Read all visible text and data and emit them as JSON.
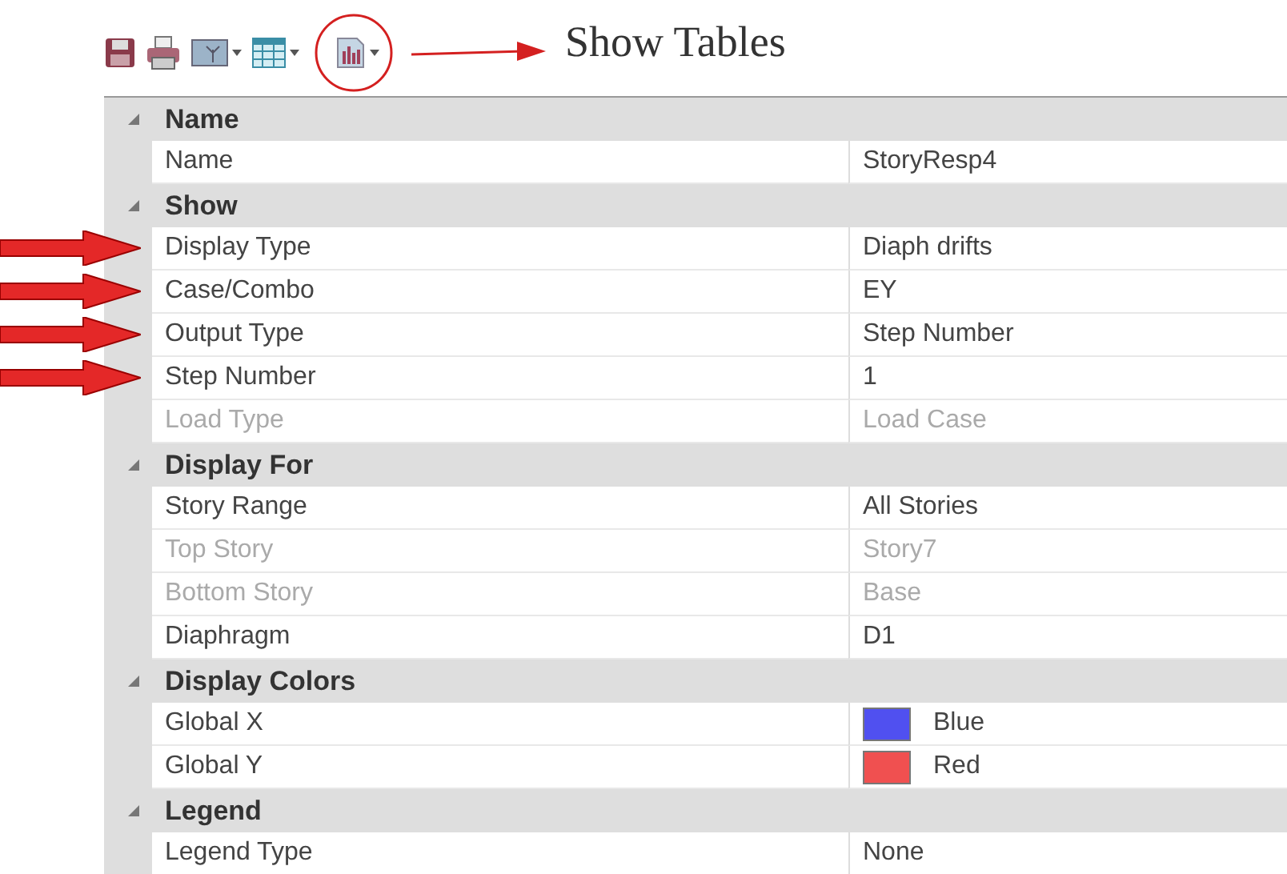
{
  "toolbar": {
    "tools": [
      {
        "kind": "save",
        "dropdown": false
      },
      {
        "kind": "print",
        "dropdown": false
      },
      {
        "kind": "picture",
        "dropdown": true
      },
      {
        "kind": "table",
        "dropdown": true
      },
      {
        "kind": "chart",
        "dropdown": true
      }
    ]
  },
  "annotation": {
    "label": "Show Tables"
  },
  "sections": [
    {
      "title": "Name",
      "expanded": true,
      "items": [
        {
          "label": "Name",
          "value": "StoryResp4",
          "disabled": false,
          "arrow": false
        }
      ]
    },
    {
      "title": "Show",
      "expanded": true,
      "items": [
        {
          "label": "Display Type",
          "value": "Diaph drifts",
          "disabled": false,
          "arrow": true
        },
        {
          "label": "Case/Combo",
          "value": "EY",
          "disabled": false,
          "arrow": true
        },
        {
          "label": "Output Type",
          "value": "Step Number",
          "disabled": false,
          "arrow": true
        },
        {
          "label": "Step Number",
          "value": "1",
          "disabled": false,
          "arrow": true
        },
        {
          "label": "Load Type",
          "value": "Load Case",
          "disabled": true,
          "arrow": false
        }
      ]
    },
    {
      "title": "Display For",
      "expanded": true,
      "items": [
        {
          "label": "Story Range",
          "value": "All Stories",
          "disabled": false,
          "arrow": false
        },
        {
          "label": "Top Story",
          "value": "Story7",
          "disabled": true,
          "arrow": false
        },
        {
          "label": "Bottom Story",
          "value": "Base",
          "disabled": true,
          "arrow": false
        },
        {
          "label": "Diaphragm",
          "value": "D1",
          "disabled": false,
          "arrow": false
        }
      ]
    },
    {
      "title": "Display Colors",
      "expanded": true,
      "items": [
        {
          "label": "Global X",
          "value": "Blue",
          "color": "#5050f0",
          "disabled": false,
          "arrow": false
        },
        {
          "label": "Global Y",
          "value": "Red",
          "color": "#f05050",
          "disabled": false,
          "arrow": false
        }
      ]
    },
    {
      "title": "Legend",
      "expanded": true,
      "items": [
        {
          "label": "Legend Type",
          "value": "None",
          "disabled": false,
          "arrow": false
        }
      ]
    }
  ]
}
